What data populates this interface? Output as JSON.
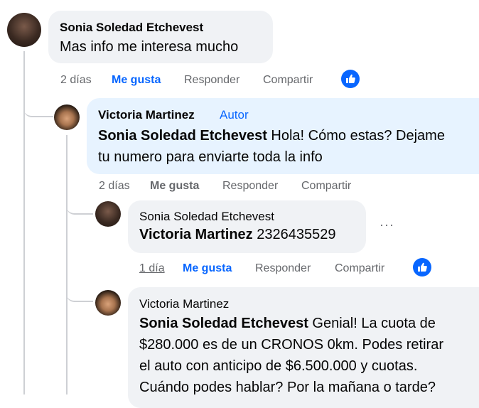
{
  "comments": [
    {
      "author": "Sonia Soledad Etchevest",
      "text": "Mas info me interesa mucho",
      "time": "2 días",
      "like_label": "Me gusta",
      "reply_label": "Responder",
      "share_label": "Compartir"
    },
    {
      "author": "Victoria Martinez",
      "author_badge": "Autor",
      "mention": "Sonia Soledad Etchevest",
      "text": " Hola! Cómo estas? Dejame",
      "text2": "tu numero para enviarte toda la info",
      "time": "2 días",
      "like_label": "Me gusta",
      "reply_label": "Responder",
      "share_label": "Compartir"
    },
    {
      "author": "Sonia Soledad Etchevest",
      "mention": "Victoria Martinez",
      "text": " 2326435529",
      "time": "1 día",
      "like_label": "Me gusta",
      "reply_label": "Responder",
      "share_label": "Compartir",
      "more": "···"
    },
    {
      "author": "Victoria Martinez",
      "mention": "Sonia Soledad Etchevest",
      "text": " Genial! La cuota de",
      "text2": "$280.000 es de un CRONOS 0km. Podes retirar",
      "text3": "el auto con anticipo de $6.500.000 y cuotas.",
      "text4": "Cuándo podes hablar? Por la mañana o tarde?"
    }
  ],
  "colors": {
    "accent": "#0866ff",
    "bubble": "#f0f2f5",
    "author_bubble": "#e7f3ff",
    "meta": "#65676b"
  },
  "icons": [
    "like-thumb-icon",
    "more-options-icon"
  ]
}
